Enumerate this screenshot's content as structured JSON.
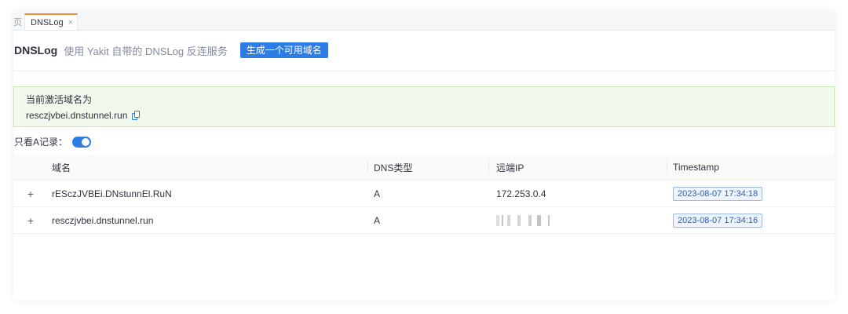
{
  "tabs": {
    "prev_label": "页",
    "active_label": "DNSLog",
    "close_glyph": "×"
  },
  "header": {
    "title": "DNSLog",
    "description": "使用 Yakit 自带的 DNSLog 反连服务",
    "generate_button": "生成一个可用域名"
  },
  "alert": {
    "label": "当前激活域名为",
    "domain": "resczjvbei.dnstunnel.run",
    "icon": "copy-icon"
  },
  "filter": {
    "label": "只看A记录：",
    "enabled": true
  },
  "table": {
    "columns": [
      "域名",
      "DNS类型",
      "远端IP",
      "Timestamp"
    ],
    "rows": [
      {
        "expand": "+",
        "domain": "rESczJVBEi.DNstunnEl.RuN",
        "type": "A",
        "ip": "172.253.0.4",
        "timestamp": "2023-08-07 17:34:18"
      },
      {
        "expand": "+",
        "domain": "resczjvbei.dnstunnel.run",
        "type": "A",
        "ip": "",
        "ip_obscured": true,
        "timestamp": "2023-08-07 17:34:16"
      }
    ]
  },
  "colors": {
    "accent": "#2e7de6",
    "tab_indicator": "#f28b40",
    "alert_bg": "#f0f9eb",
    "alert_border": "#cde8b8"
  }
}
